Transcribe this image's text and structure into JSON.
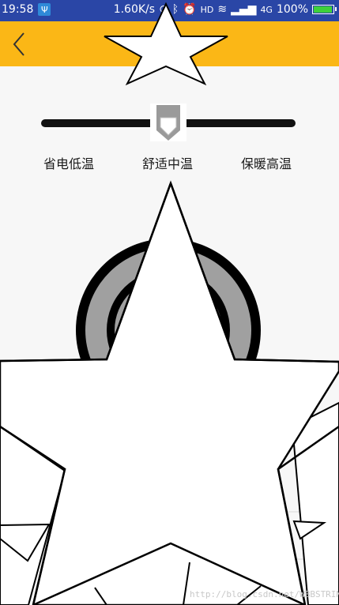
{
  "status_bar": {
    "time": "19:58",
    "usb_icon": "usb-icon",
    "net_speed": "1.60K/s",
    "network": "4G",
    "battery_percent": "100%",
    "battery_level": 1.0,
    "battery_color": "#3ed13b",
    "hd_badge": "HD"
  },
  "toolbar": {
    "background": "#fbb716",
    "back_icon": "chevron-left-icon"
  },
  "temperature_slider": {
    "options": [
      "省电低温",
      "舒适中温",
      "保暖高温"
    ],
    "selected_index": 1,
    "selected_position": 0.5
  },
  "watermark": "http://blog.csdn.net/WBBSTRING"
}
